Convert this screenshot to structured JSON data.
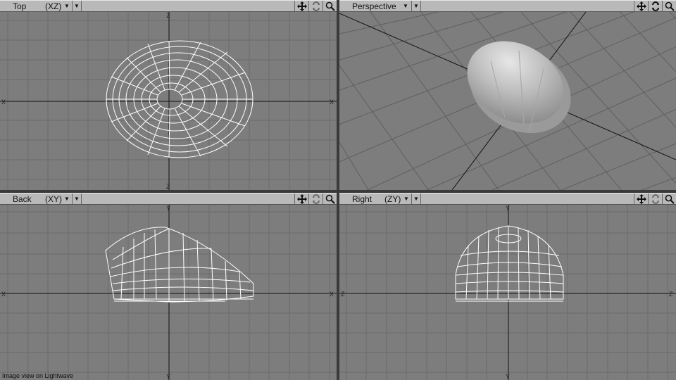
{
  "viewports": {
    "top": {
      "title": "Top",
      "axes": "(XZ)",
      "axis_labels": {
        "up": "Z",
        "down": "Z",
        "left": "X",
        "right": "X"
      }
    },
    "persp": {
      "title": "Perspective",
      "axes": ""
    },
    "back": {
      "title": "Back",
      "axes": "(XY)",
      "axis_labels": {
        "up": "Y",
        "down": "Y",
        "left": "X",
        "right": "X"
      }
    },
    "right": {
      "title": "Right",
      "axes": "(ZY)",
      "axis_labels": {
        "up": "Y",
        "down": "Y",
        "left": "Z",
        "right": "Z"
      }
    }
  },
  "icons": {
    "move": "move-icon",
    "rotate": "rotate-icon",
    "zoom": "zoom-icon",
    "dropdown": "chevron-down-icon"
  },
  "caption": "Image view on Lightwave",
  "colors": {
    "viewport_bg": "#7d7d7d",
    "grid": "#6b6b6b",
    "axis": "#111111",
    "header_bg": "#b9b9b9",
    "wire": "#ffffff"
  }
}
